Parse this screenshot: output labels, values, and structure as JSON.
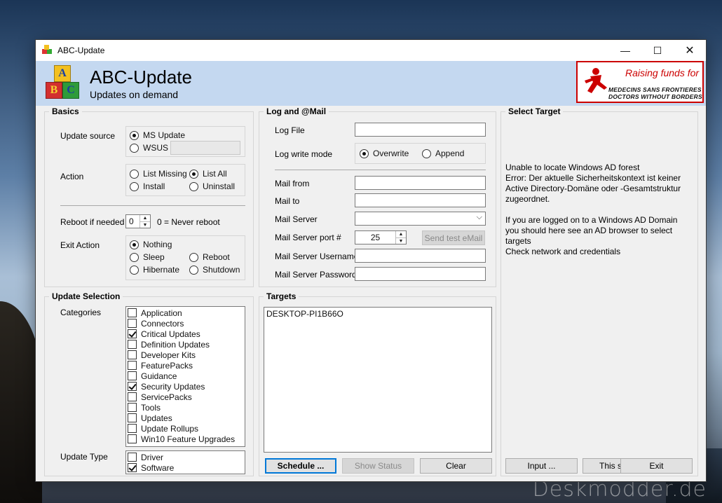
{
  "window": {
    "title": "ABC-Update",
    "min_glyph": "—",
    "max_glyph": "☐",
    "close_glyph": "✕"
  },
  "header": {
    "app_name": "ABC-Update",
    "tagline": "Updates on demand",
    "logo_letters": [
      "A",
      "B",
      "C"
    ],
    "banner": {
      "raising": "Raising funds for",
      "line1": "MEDECINS SANS FRONTIERES",
      "line2": "DOCTORS WITHOUT BORDERS",
      "color": "#cc0000"
    }
  },
  "basics": {
    "title": "Basics",
    "update_source_label": "Update source",
    "source_options": [
      "MS Update",
      "WSUS"
    ],
    "source_selected": "MS Update",
    "action_label": "Action",
    "action_options": [
      "List Missing",
      "List All",
      "Install",
      "Uninstall"
    ],
    "action_selected": "List All",
    "reboot_label": "Reboot if needed",
    "reboot_value": "0",
    "reboot_hint": "0 = Never reboot",
    "exit_label": "Exit Action",
    "exit_options": [
      "Nothing",
      "Reboot",
      "Sleep",
      "Hibernate",
      "Shutdown"
    ],
    "exit_selected": "Nothing"
  },
  "log_mail": {
    "title": "Log  and  @Mail",
    "log_file_label": "Log File",
    "log_file_value": "",
    "write_mode_label": "Log write mode",
    "write_modes": [
      "Overwrite",
      "Append"
    ],
    "write_mode_selected": "Overwrite",
    "mail_from_label": "Mail from",
    "mail_to_label": "Mail to",
    "mail_server_label": "Mail Server",
    "mail_port_label": "Mail Server port #",
    "mail_port_value": "25",
    "send_test_label": "Send test eMail",
    "username_label": "Mail Server Username",
    "password_label": "Mail Server Password"
  },
  "select_target": {
    "title": "Select Target",
    "messages": [
      "Unable to locate Windows AD forest",
      "Error: Der aktuelle Sicherheitskontext ist keiner Active Directory-Domäne oder -Gesamtstruktur zugeordnet.",
      "",
      "If you are logged on to a Windows AD Domain you should here see an AD browser to select targets",
      "Check network and credentials"
    ],
    "input_button": "Input ...",
    "this_button": "This sy",
    "exit_button": "Exit"
  },
  "update_selection": {
    "title": "Update Selection",
    "categories_label": "Categories",
    "categories": [
      {
        "name": "Application",
        "checked": false
      },
      {
        "name": "Connectors",
        "checked": false
      },
      {
        "name": "Critical Updates",
        "checked": true
      },
      {
        "name": "Definition Updates",
        "checked": false
      },
      {
        "name": "Developer Kits",
        "checked": false
      },
      {
        "name": "FeaturePacks",
        "checked": false
      },
      {
        "name": "Guidance",
        "checked": false
      },
      {
        "name": "Security Updates",
        "checked": true
      },
      {
        "name": "ServicePacks",
        "checked": false
      },
      {
        "name": "Tools",
        "checked": false
      },
      {
        "name": "Updates",
        "checked": false
      },
      {
        "name": "Update Rollups",
        "checked": false
      },
      {
        "name": "Win10 Feature Upgrades",
        "checked": false
      }
    ],
    "update_type_label": "Update Type",
    "update_types": [
      {
        "name": "Driver",
        "checked": false
      },
      {
        "name": "Software",
        "checked": true
      }
    ]
  },
  "targets": {
    "title": "Targets",
    "items": [
      "DESKTOP-PI1B66O"
    ],
    "schedule_button": "Schedule ...",
    "show_status_button": "Show Status",
    "clear_button": "Clear"
  },
  "desktop": {
    "watermark": "Deskmodder.de"
  }
}
